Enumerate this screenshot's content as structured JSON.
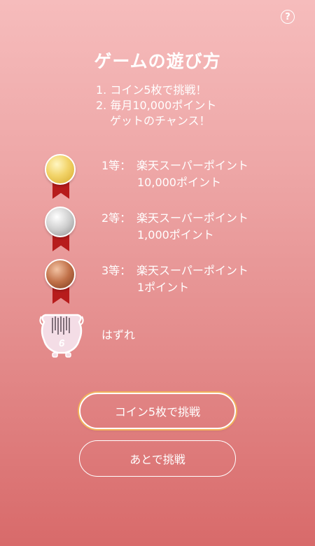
{
  "help": {
    "icon": "help-icon",
    "glyph": "?"
  },
  "title": "ゲームの遊び方",
  "rules": [
    "1. コイン5枚で挑戦！",
    "2. 毎月10,000ポイント",
    "   ゲットのチャンス！"
  ],
  "prizes": [
    {
      "rank": "1等：",
      "line1": "楽天スーパーポイント",
      "line2": "10,000ポイント",
      "medal": "gold-medal-icon"
    },
    {
      "rank": "2等：",
      "line1": "楽天スーパーポイント",
      "line2": "1,000ポイント",
      "medal": "silver-medal-icon"
    },
    {
      "rank": "3等：",
      "line1": "楽天スーパーポイント",
      "line2": "1ポイント",
      "medal": "bronze-medal-icon"
    }
  ],
  "lose": {
    "label": "はずれ",
    "icon": "piggy-bank-icon",
    "pig_text": "6"
  },
  "buttons": {
    "challenge": "コイン5枚で挑戦",
    "later": "あとで挑戦"
  }
}
